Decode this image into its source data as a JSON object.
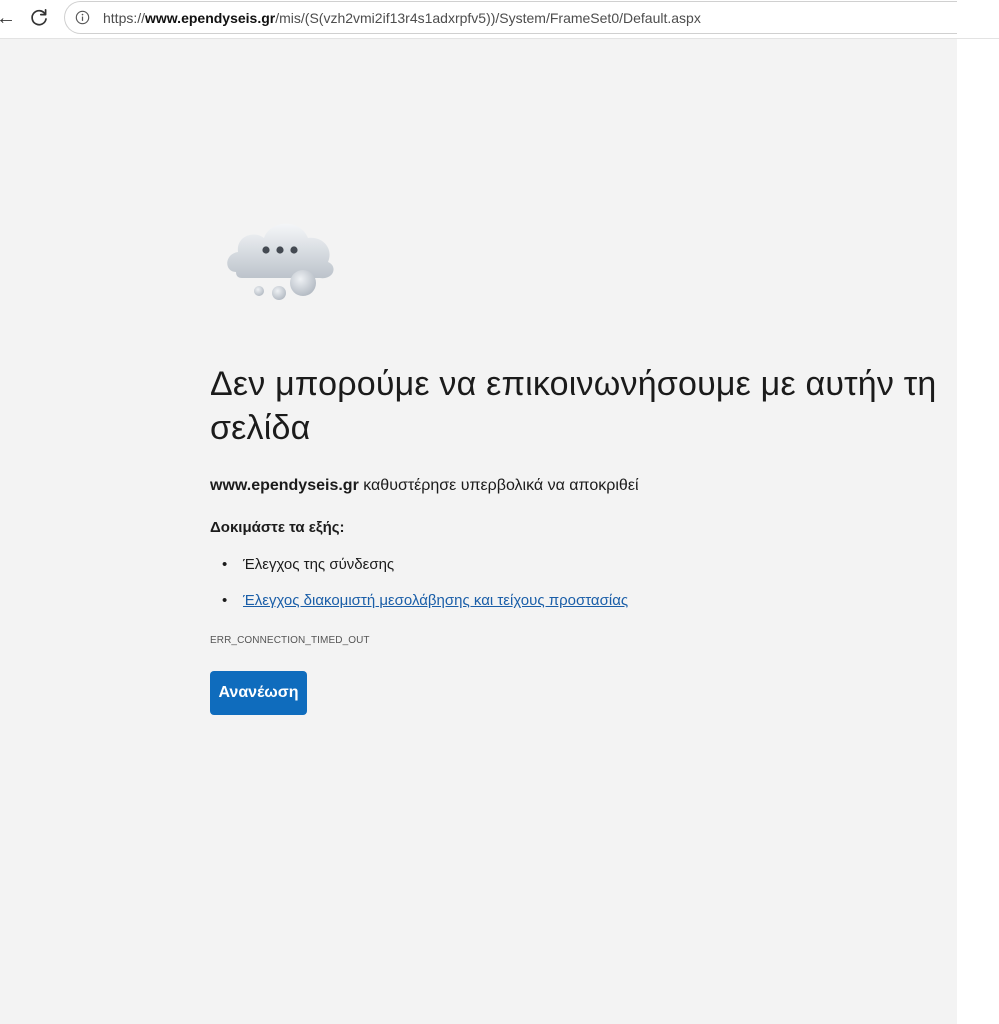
{
  "browser": {
    "url_prefix": "https://",
    "url_domain": "www.ependyseis.gr",
    "url_path": "/mis/(S(vzh2vmi2if13r4s1adxrpfv5))/System/FrameSet0/Default.aspx",
    "icons": {
      "back": "back-arrow-icon",
      "reload": "reload-icon",
      "info": "info-icon"
    }
  },
  "error_page": {
    "icon": "cloud-icon",
    "headline": "Δεν μπορούμε να επικοινωνήσουμε με αυτήν τη σελίδα",
    "description_host": "www.ependyseis.gr",
    "description_text": " καθυστέρησε υπερβολικά να αποκριθεί",
    "try_heading": "Δοκιμάστε τα εξής:",
    "suggestions": [
      {
        "label": "Έλεγχος της σύνδεσης",
        "link": false
      },
      {
        "label": "Έλεγχος διακομιστή μεσολάβησης και τείχους προστασίας",
        "link": true
      }
    ],
    "error_code": "ERR_CONNECTION_TIMED_OUT",
    "refresh_label": "Ανανέωση"
  },
  "colors": {
    "page_background": "#f3f3f3",
    "button": "#0f6cbd",
    "link": "#1a5ea8"
  }
}
